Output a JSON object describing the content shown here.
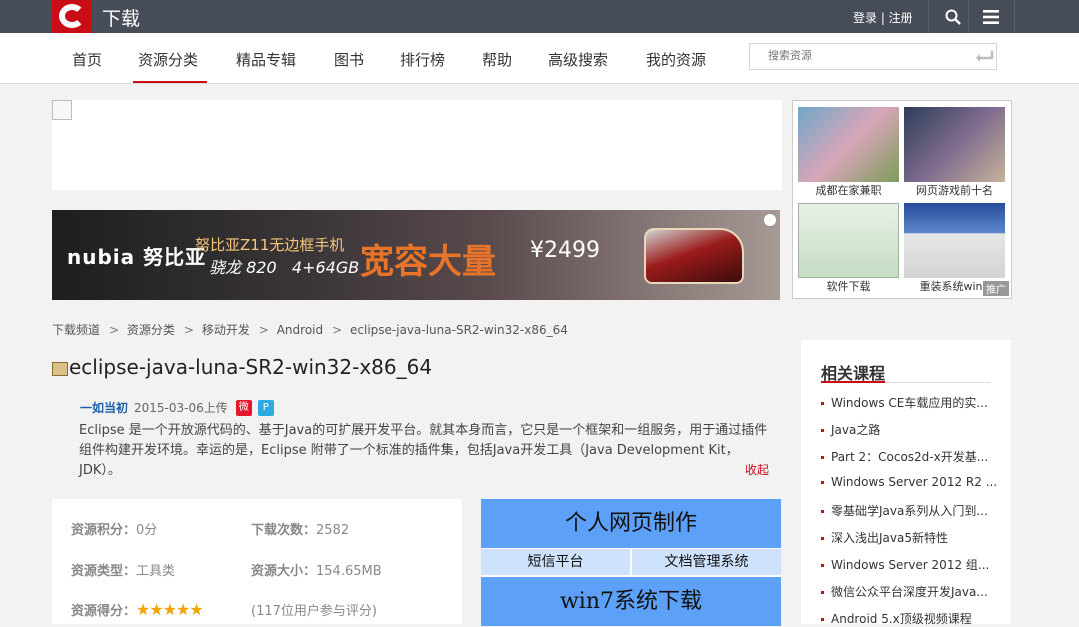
{
  "topbar": {
    "site_title": "下载",
    "login_label": "登录 | 注册"
  },
  "nav": {
    "items": [
      "首页",
      "资源分类",
      "精品专辑",
      "图书",
      "排行榜",
      "帮助",
      "高级搜索",
      "我的资源"
    ],
    "active_index": 1,
    "search_placeholder": "搜索资源"
  },
  "banner": {
    "brand": "nubia 努比亚",
    "headline": "努比亚Z11无边框手机",
    "spec": "骁龙 820   4+64GB",
    "slogan": "宽容大量",
    "price": "¥2499"
  },
  "side_ads": {
    "captions": [
      "成都在家兼职",
      "网页游戏前十名",
      "软件下载",
      "重装系统win7"
    ],
    "tag": "推广"
  },
  "breadcrumb": [
    "下载频道",
    "资源分类",
    "移动开发",
    "Android",
    "eclipse-java-luna-SR2-win32-x86_64"
  ],
  "resource": {
    "title": "eclipse-java-luna-SR2-win32-x86_64",
    "author": "一如当初",
    "upload_info": "2015-03-06上传",
    "description": "Eclipse 是一个开放源代码的、基于Java的可扩展开发平台。就其本身而言，它只是一个框架和一组服务，用于通过插件组件构建开发环境。幸运的是，Eclipse 附带了一个标准的插件集，包括Java开发工具（Java Development Kit，JDK）。",
    "collapse_label": "收起"
  },
  "stats": {
    "points_label": "资源积分：",
    "points_value": "0分",
    "downloads_label": "下载次数：",
    "downloads_value": "2582",
    "type_label": "资源类型：",
    "type_value": "工具类",
    "size_label": "资源大小：",
    "size_value": "154.65MB",
    "rating_label": "资源得分：",
    "rating_stars": 5,
    "rating_count": "(117位用户参与评分)"
  },
  "promo": {
    "big1": "个人网页制作",
    "small1": "短信平台",
    "small2": "文档管理系统",
    "big2": "win7系统下载"
  },
  "related": {
    "title": "相关课程",
    "items": [
      "Windows CE车载应用的实...",
      "Java之路",
      "Part 2：Cocos2d-x开发基...",
      "Windows Server 2012 R2 ...",
      "零基础学Java系列从入门到...",
      "深入浅出Java5新特性",
      "Windows Server 2012 组...",
      "微信公众平台深度开发Java...",
      "Android 5.x顶级视频课程"
    ]
  },
  "colors": {
    "brand_red": "#ca0c16",
    "topbar": "#464c58",
    "promo_blue": "#5da0f7"
  }
}
